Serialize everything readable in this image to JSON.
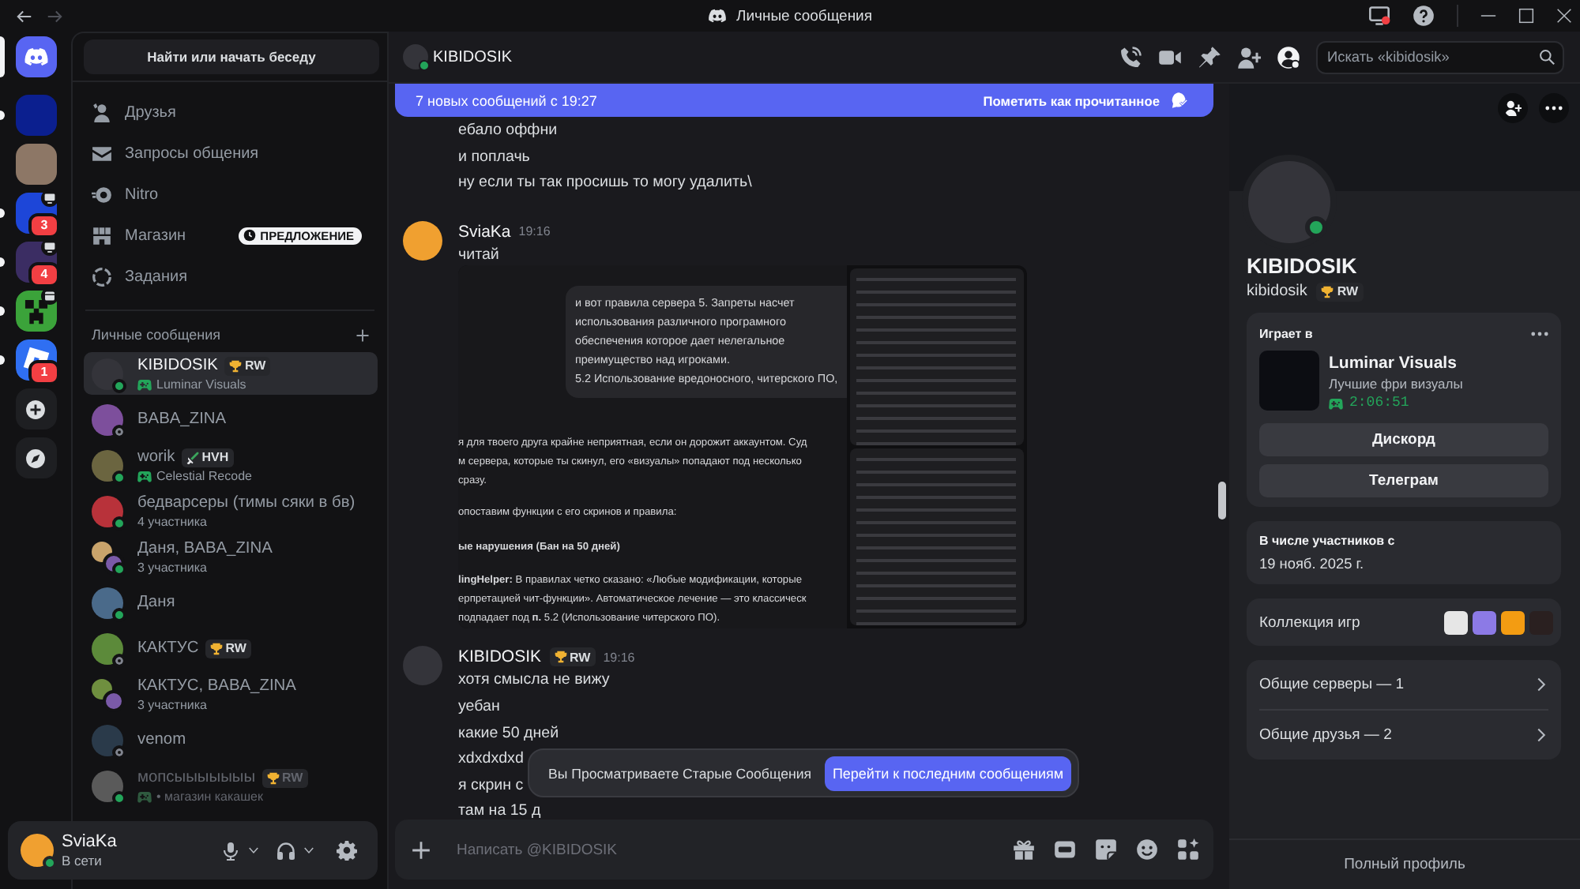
{
  "titlebar": {
    "title": "Личные сообщения"
  },
  "servers": [
    {
      "kind": "home",
      "selected": true
    },
    {
      "kind": "image",
      "color": "#0b1f8f",
      "selected": false,
      "unread": true
    },
    {
      "kind": "photo",
      "selected": false,
      "unread": false
    },
    {
      "kind": "image",
      "color": "#1d46d8",
      "selected": false,
      "unread": true,
      "badge": "3",
      "activity": {
        "kind": "screen"
      }
    },
    {
      "kind": "image",
      "color": "#3b2d63",
      "selected": false,
      "unread": true,
      "badge": "4",
      "activity": {
        "kind": "screen"
      }
    },
    {
      "kind": "creeper",
      "selected": false,
      "unread": true,
      "activity": {
        "kind": "event"
      }
    },
    {
      "kind": "roblox",
      "selected": false,
      "unread": true,
      "badge": "1"
    },
    {
      "kind": "add",
      "selected": false,
      "unread": false
    },
    {
      "kind": "discover",
      "selected": false,
      "unread": false
    }
  ],
  "search": {
    "label": "Найти или начать беседу"
  },
  "nav": [
    {
      "kind": "friends",
      "label": "Друзья"
    },
    {
      "kind": "requests",
      "label": "Запросы общения"
    },
    {
      "kind": "nitro",
      "label": "Nitro"
    },
    {
      "kind": "shop",
      "label": "Магазин",
      "badge": "ПРЕДЛОЖЕНИЕ"
    },
    {
      "kind": "quests",
      "label": "Задания"
    }
  ],
  "dm_header": {
    "title": "Личные сообщения"
  },
  "dms": [
    {
      "name": "KIBIDOSIK",
      "kind": "user",
      "color": "#34343a",
      "online": true,
      "selected": true,
      "muted": false,
      "badge": {
        "kind": "trophy",
        "label": "RW"
      },
      "subtitle": "Luminar Visuals",
      "playing": true
    },
    {
      "name": "BABA_ZINA",
      "kind": "user",
      "color": "#7d4f9c",
      "online": false,
      "selected": false,
      "muted": false
    },
    {
      "name": "worik",
      "kind": "user",
      "color": "#6b6540",
      "online": true,
      "selected": false,
      "muted": false,
      "badge": {
        "kind": "sword",
        "label": "HVH"
      },
      "subtitle": "Celestial Recode",
      "playing": true
    },
    {
      "name": "бедварсеры (тимы сяки в бв)",
      "kind": "user",
      "color": "#b8323a",
      "online": true,
      "selected": false,
      "muted": false,
      "subtitle": "4 участника",
      "playing": false
    },
    {
      "name": "Даня, BABA_ZINA",
      "kind": "group",
      "color": "#c9a36b",
      "online": true,
      "selected": false,
      "muted": false,
      "subtitle": "3 участника",
      "playing": false
    },
    {
      "name": "Даня",
      "kind": "user",
      "color": "#4a6a8a",
      "online": true,
      "selected": false,
      "muted": false
    },
    {
      "name": "КАКТУС",
      "kind": "user",
      "color": "#5c8a3a",
      "online": false,
      "selected": false,
      "muted": false,
      "badge": {
        "kind": "trophy",
        "label": "RW"
      }
    },
    {
      "name": "КАКТУС, BABA_ZINA",
      "kind": "group",
      "color": "#6f8f3f",
      "selected": false,
      "muted": false,
      "subtitle": "3 участника",
      "playing": false
    },
    {
      "name": "venom",
      "kind": "user",
      "color": "#2a3a4a",
      "online": false,
      "selected": false,
      "muted": false
    },
    {
      "name": "мопсыыыыыыы",
      "kind": "user",
      "color": "#5a5a5a",
      "online": true,
      "selected": false,
      "muted": true,
      "badge": {
        "kind": "trophy",
        "label": "RW"
      },
      "subtitle": "• магазин какашек",
      "playing": true
    }
  ],
  "user": {
    "name": "SviaKa",
    "status_text": "В сети",
    "color": "#f0a030",
    "online": true
  },
  "chat": {
    "header": {
      "name": "KIBIDOSIK",
      "color": "#34343a",
      "online": true
    },
    "search": {
      "placeholder": "Искать «kibidosik»"
    },
    "banner": {
      "text": "7 новых сообщений с 19:27",
      "action": "Пометить как прочитанное"
    },
    "messages": [
      {
        "kind": "continuation",
        "lines": [
          "ебало оффни",
          "и поплачь",
          "ну если ты так просишь то могу удалить\\"
        ]
      },
      {
        "kind": "group",
        "author": "SviaKa",
        "color": "#f0a030",
        "time": "19:16",
        "lines": [
          "читай"
        ],
        "attachment": {
          "kind": "screenshot",
          "bubble": [
            "и вот правила сервера 5. Запреты насчет использования различного програмного обеспечения которое дает нелегальное преимущество над игроками.",
            "5.2 Использование вредоносного, читерского ПО,"
          ],
          "paragraphs": [
            {
              "kind": "text",
              "lines": [
                "я для твоего друга крайне неприятная, если он дорожит аккаунтом. Суд",
                "м сервера, которые ты скинул, его «визуалы» попадают под несколько",
                "сразу."
              ]
            },
            {
              "kind": "text",
              "lines": [
                "опоставим функции с его скринов и правила:"
              ]
            },
            {
              "kind": "heading",
              "lines": [
                "ые нарушения (Бан на 50 дней)"
              ]
            },
            {
              "kind": "text",
              "lines": [
                "**lingHelper:** В правилах четко сказано: «Любые модификации, которые",
                "ерпретацией чит-функции». Автоматическое лечение — это классическ",
                "подпадает под **п.** 5.2 (Использование читерского ПО)."
              ]
            }
          ]
        }
      },
      {
        "kind": "group",
        "author": "KIBIDOSIK",
        "color": "#34343a",
        "badge": {
          "kind": "trophy",
          "label": "RW"
        },
        "time": "19:16",
        "lines": [
          "хотя смысла не вижу",
          "уебан",
          "какие 50 дней",
          "xdxdxdxd",
          "я скрин с",
          "там на 15 д"
        ]
      }
    ],
    "toast": {
      "text": "Вы Просматриваете Старые Сообщения",
      "button": "Перейти к последним сообщениям"
    },
    "composer": {
      "placeholder": "Написать @KIBIDOSIK"
    }
  },
  "profile": {
    "name": "KIBIDOSIK",
    "username": "kibidosik",
    "color": "#34343a",
    "online": true,
    "badge": {
      "kind": "trophy",
      "label": "RW"
    },
    "activity": {
      "heading": "Играет в",
      "title": "Luminar Visuals",
      "details": "Лучшие фри визуалы",
      "elapsed": "2:06:51",
      "buttons": [
        "Дискорд",
        "Телеграм"
      ]
    },
    "member_since": {
      "label": "В числе участников с",
      "date": "19 нояб. 2025 г."
    },
    "games": {
      "label": "Коллекция игр",
      "items": [
        {
          "color": "#e6e6e6"
        },
        {
          "color": "#8c7ae6"
        },
        {
          "color": "#f39c12"
        },
        {
          "color": "#2a2020"
        }
      ]
    },
    "mutual": [
      "Общие серверы — 1",
      "Общие друзья — 2"
    ],
    "footer": "Полный профиль"
  }
}
